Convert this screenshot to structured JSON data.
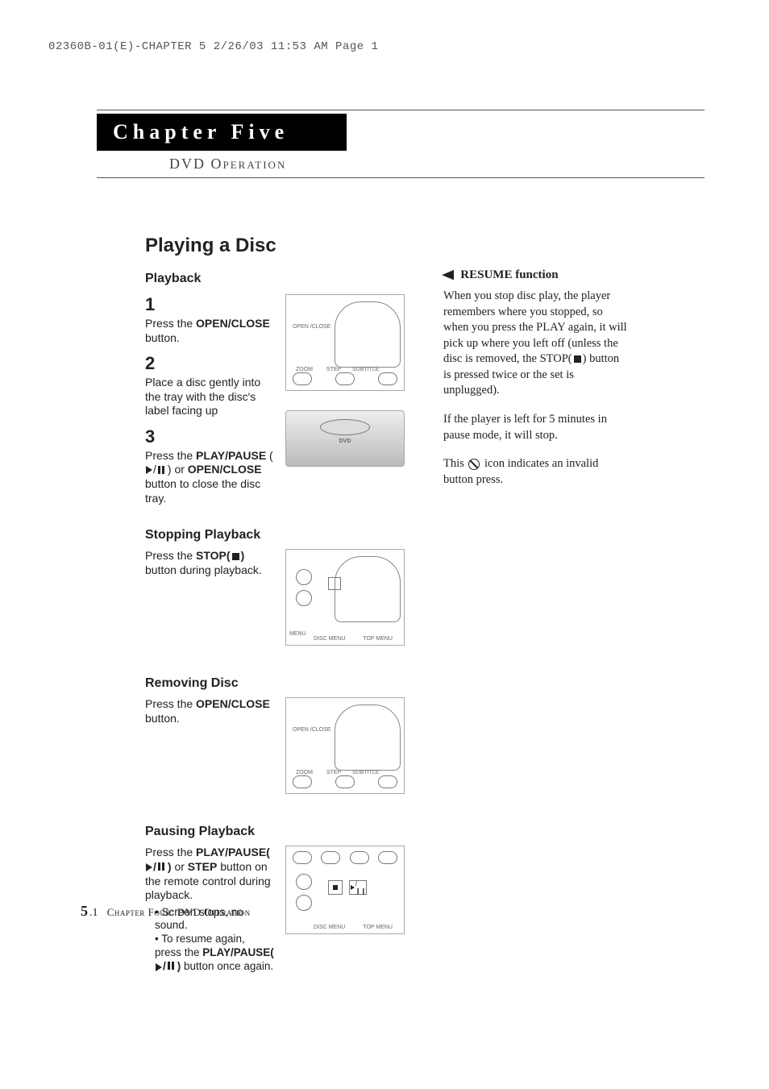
{
  "print_header": "02360B-01(E)-CHAPTER 5  2/26/03  11:53 AM  Page 1",
  "chapter": {
    "title": "Chapter Five",
    "subtitle": "DVD Operation"
  },
  "main_title": "Playing a Disc",
  "sections": {
    "playback": {
      "heading": "Playback",
      "steps": [
        {
          "num": "1",
          "text_a": "Press the ",
          "bold": "OPEN/CLOSE",
          "text_b": " button."
        },
        {
          "num": "2",
          "text_a": "Place a disc gently into the tray with the disc's label facing up",
          "bold": "",
          "text_b": ""
        },
        {
          "num": "3",
          "text_a": "Press the ",
          "bold": "PLAY/PAUSE",
          "text_b": " (▶/❙❙ ) or OPEN/CLOSE button to close the disc tray."
        }
      ],
      "fig1_labels": [
        "OPEN /CLOSE",
        "ZOOM",
        "STEP",
        "SUBTITLE"
      ],
      "fig2_label": "DVD"
    },
    "stopping": {
      "heading": "Stopping Playback",
      "text_a": "Press the ",
      "bold": "STOP( ■ )",
      "text_b": " button during playback.",
      "fig_labels": [
        "DISC MENU",
        "TOP MENU",
        "MENU"
      ]
    },
    "removing": {
      "heading": "Removing Disc",
      "text_a": "Press the ",
      "bold": "OPEN/CLOSE",
      "text_b": " button.",
      "fig_labels": [
        "OPEN /CLOSE",
        "ZOOM",
        "STEP",
        "SUBTITLE"
      ]
    },
    "pausing": {
      "heading": "Pausing Playback",
      "para_a": "Press the ",
      "para_bold1": "PLAY/PAUSE( ▶/❙❙ )",
      "para_b": " or ",
      "para_bold2": "STEP",
      "para_c": " button on the remote control during playback.",
      "bullets": [
        "Screen stops, no sound.",
        "To resume again, press the PLAY/PAUSE( ▶/❙❙ ) button once again."
      ],
      "fig_labels": [
        "DISC MENU",
        "TOP MENU"
      ]
    }
  },
  "side": {
    "pointer": "◀",
    "heading": "RESUME function",
    "para1": "When you stop disc play, the player remembers where you stopped, so when you press the PLAY again, it will pick up where you left off (unless the disc is removed, the STOP( ■ ) button is pressed twice or the set is unplugged).",
    "para2": "If the player is left for 5 minutes in pause mode, it will stop.",
    "para3_a": "This ",
    "para3_b": " icon indicates an invalid button press."
  },
  "footer": {
    "chapnum": "5",
    "subnum": ".1",
    "text": "Chapter Four: DVD Operation"
  }
}
